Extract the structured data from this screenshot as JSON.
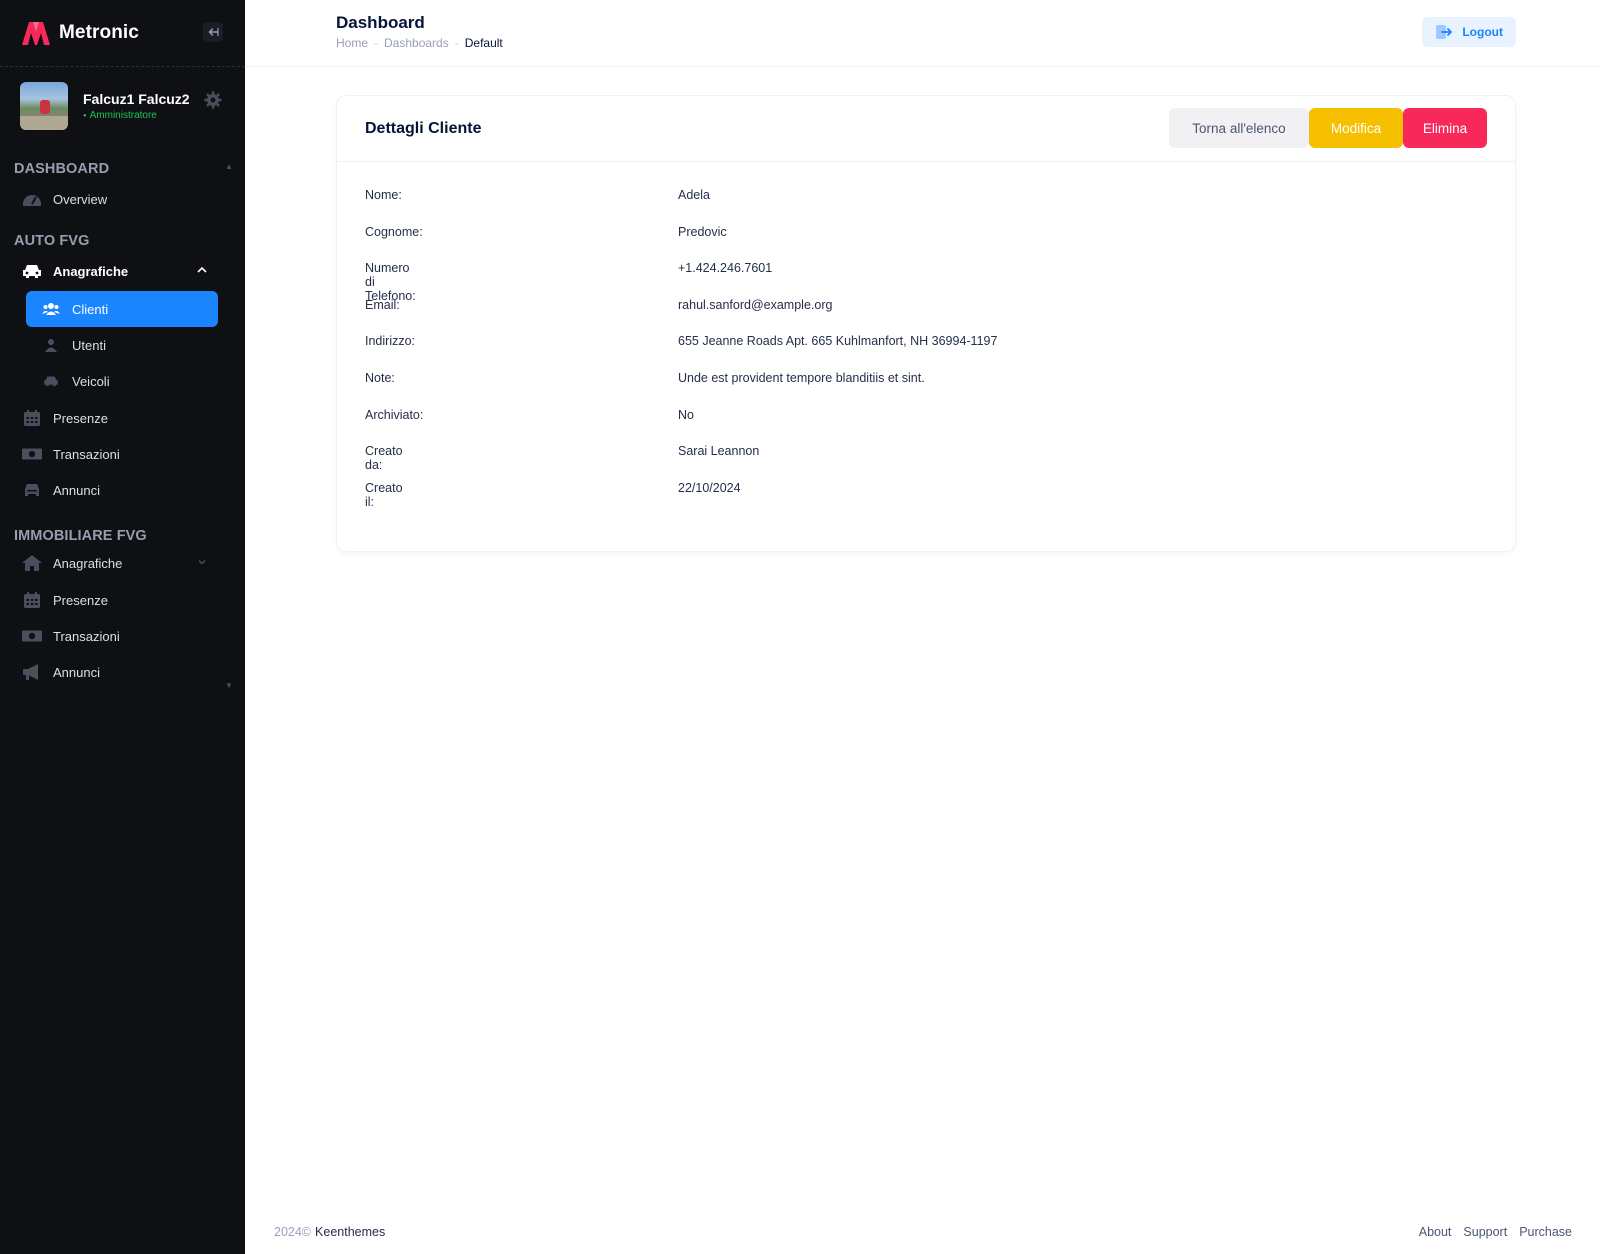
{
  "app": {
    "name": "Metronic"
  },
  "user": {
    "name": "Falcuz1 Falcuz2",
    "role": "Amministratore"
  },
  "sidebar": {
    "sections": [
      {
        "title": "DASHBOARD"
      },
      {
        "title": "AUTO FVG"
      },
      {
        "title": "IMMOBILIARE FVG"
      }
    ],
    "dashboard_items": [
      {
        "label": "Overview"
      }
    ],
    "auto_items": [
      {
        "label": "Anagrafiche"
      },
      {
        "label": "Clienti"
      },
      {
        "label": "Utenti"
      },
      {
        "label": "Veicoli"
      },
      {
        "label": "Presenze"
      },
      {
        "label": "Transazioni"
      },
      {
        "label": "Annunci"
      }
    ],
    "immobiliare_items": [
      {
        "label": "Anagrafiche"
      },
      {
        "label": "Presenze"
      },
      {
        "label": "Transazioni"
      },
      {
        "label": "Annunci"
      }
    ]
  },
  "header": {
    "title": "Dashboard",
    "breadcrumb": [
      "Home",
      "Dashboards",
      "Default"
    ],
    "logout_label": "Logout"
  },
  "card": {
    "title": "Dettagli Cliente",
    "buttons": {
      "back": "Torna all'elenco",
      "edit": "Modifica",
      "delete": "Elimina"
    },
    "fields": [
      {
        "label": "Nome:",
        "value": "Adela"
      },
      {
        "label": "Cognome:",
        "value": "Predovic"
      },
      {
        "label": "Numero di Telefono:",
        "value": "+1.424.246.7601"
      },
      {
        "label": "Email:",
        "value": "rahul.sanford@example.org"
      },
      {
        "label": "Indirizzo:",
        "value": "655 Jeanne Roads Apt. 665 Kuhlmanfort, NH 36994-1197"
      },
      {
        "label": "Note:",
        "value": "Unde est provident tempore blanditiis et sint."
      },
      {
        "label": "Archiviato:",
        "value": "No"
      },
      {
        "label": "Creato da:",
        "value": "Sarai Leannon"
      },
      {
        "label": "Creato il:",
        "value": "22/10/2024"
      }
    ]
  },
  "footer": {
    "year": "2024©",
    "brand": "Keenthemes",
    "links": [
      "About",
      "Support",
      "Purchase"
    ]
  },
  "colors": {
    "sidebar_bg": "#0f1014",
    "primary": "#1b84ff",
    "warning": "#f6c000",
    "danger": "#f8285a",
    "success": "#17c653"
  }
}
